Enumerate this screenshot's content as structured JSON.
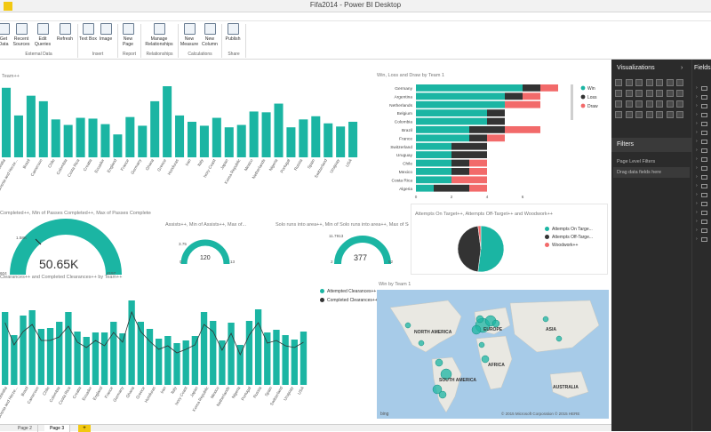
{
  "window": {
    "title": "Fifa2014 - Power BI Desktop"
  },
  "ribbon": {
    "buttons": [
      {
        "label": "Get Data"
      },
      {
        "label": "Recent Sources"
      },
      {
        "label": "Edit Queries"
      },
      {
        "label": "Refresh"
      },
      {
        "label": "Text Box"
      },
      {
        "label": "Image"
      },
      {
        "label": "New Page"
      },
      {
        "label": "Manage Relationships"
      },
      {
        "label": "New Measure"
      },
      {
        "label": "New Column"
      },
      {
        "label": "Publish"
      }
    ],
    "groups": [
      "External Data",
      "Insert",
      "Report",
      "Relationships",
      "Calculations",
      "Share"
    ]
  },
  "visuals": {
    "top_bar_title": "Team++",
    "top_bar_labels": [
      "Australia",
      "Bosnia and Herze...",
      "Brazil",
      "Cameroon",
      "Chile",
      "Colombia",
      "Costa Rica",
      "Croatia",
      "Ecuador",
      "England",
      "France",
      "Germany",
      "Ghana",
      "Greece",
      "Honduras",
      "Iran",
      "Italy",
      "Ivory Coast",
      "Japan",
      "Korea Republic",
      "Mexico",
      "Netherlands",
      "Nigeria",
      "Portugal",
      "Russia",
      "Spain",
      "Switzerland",
      "Uruguay",
      "USA"
    ],
    "stacked_title": "Win, Loss and Draw by Team 1",
    "gauge1_title": "Completed++, Min of Passes Completed++, Max of Passes Completed++",
    "gauge1": {
      "value": "50.65K",
      "target": "1.58K",
      "min": "604",
      "max": "4157"
    },
    "gauge2_title": "Assists++, Min of Assists++, Max of...",
    "gauge2": {
      "value": "120",
      "target": "3.75",
      "min": "0",
      "max": "13"
    },
    "gauge3_title": "Solo runs into area++, Min of Solo runs into area++, Max of Solo runs into...",
    "gauge3": {
      "value": "377",
      "target": "11.7913",
      "min": "2",
      "max": "52"
    },
    "pie_title": "Attempts On Target++, Attempts Off-Target++ and Woodwork++",
    "clear_title": "Clearances++ and Completed Clearances++ by Team++",
    "clear_labels": [
      "Australia",
      "Bosnia and Herze...",
      "Brazil",
      "Cameroon",
      "Chile",
      "Colombia",
      "Costa Rica",
      "Croatia",
      "Ecuador",
      "England",
      "France",
      "Germany",
      "Ghana",
      "Greece",
      "Honduras",
      "Iran",
      "Italy",
      "Ivory Coast",
      "Japan",
      "Korea Republic",
      "Mexico",
      "Netherlands",
      "Nigeria",
      "Portugal",
      "Russia",
      "Spain",
      "Switzerland",
      "Uruguay",
      "USA"
    ],
    "map_title": "Win by Team 1",
    "map_labels": [
      "NORTH AMERICA",
      "EUROPE",
      "ASIA",
      "AFRICA",
      "SOUTH AMERICA",
      "AUSTRALIA"
    ],
    "map_credit": "© 2015 Microsoft Corporation   © 2015 HERE",
    "map_brand": "bing"
  },
  "panes": {
    "visualizations": "Visualizations",
    "filters": "Filters",
    "page_level_filters": "Page Level Filters",
    "drag_fields": "Drag data fields here",
    "fields": "Fields"
  },
  "pages": [
    "Page 2",
    "Page 3"
  ],
  "add_page": "+",
  "colors": {
    "teal": "#1bb5a3",
    "dark": "#333333",
    "red": "#f26a6a"
  },
  "chart_data": [
    {
      "type": "bar",
      "categories": [
        "Australia",
        "Bosnia and Herze...",
        "Brazil",
        "Cameroon",
        "Chile",
        "Colombia",
        "Costa Rica",
        "Croatia",
        "Ecuador",
        "England",
        "France",
        "Germany",
        "Ghana",
        "Greece",
        "Honduras",
        "Iran",
        "Italy",
        "Ivory Coast",
        "Japan",
        "Korea Republic",
        "Mexico",
        "Netherlands",
        "Nigeria",
        "Portugal",
        "Russia",
        "Spain",
        "Switzerland",
        "Uruguay",
        "USA"
      ],
      "values": [
        88,
        53,
        78,
        71,
        48,
        41,
        50,
        49,
        42,
        29,
        51,
        40,
        71,
        90,
        53,
        45,
        40,
        50,
        38,
        41,
        58,
        57,
        68,
        38,
        48,
        52,
        43,
        39,
        45
      ],
      "title": "Team++"
    },
    {
      "type": "bar",
      "title": "Win, Loss and Draw by Team 1",
      "categories": [
        "Germany",
        "Argentina",
        "Netherlands",
        "Belgium",
        "Colombia",
        "Brazil",
        "France",
        "Switzerland",
        "Uruguay",
        "Chile",
        "Mexico",
        "Costa Rica",
        "Algeria"
      ],
      "series": [
        {
          "name": "Win",
          "values": [
            6,
            5,
            5,
            4,
            4,
            3,
            3,
            2,
            2,
            2,
            2,
            2,
            1
          ]
        },
        {
          "name": "Loss",
          "values": [
            1,
            1,
            0,
            1,
            1,
            2,
            1,
            2,
            2,
            1,
            1,
            0,
            2
          ]
        },
        {
          "name": "Draw",
          "values": [
            1,
            1,
            2,
            0,
            0,
            2,
            1,
            0,
            0,
            1,
            1,
            2,
            1
          ]
        }
      ],
      "xlim": [
        0,
        8
      ],
      "xticks": [
        0,
        2,
        4,
        6
      ]
    },
    {
      "type": "pie",
      "title": "Attempts On Target++, Attempts Off-Target++ and Woodwork++",
      "labels": [
        "Attempts On Targe...",
        "Attempts Off-Targe...",
        "Woodwork++"
      ],
      "values": [
        52,
        46,
        2
      ]
    },
    {
      "type": "bar",
      "title": "Clearances++ and Completed Clearances++ by Team++",
      "categories": [
        "Australia",
        "Bosnia and Herze...",
        "Brazil",
        "Cameroon",
        "Chile",
        "Colombia",
        "Costa Rica",
        "Croatia",
        "Ecuador",
        "England",
        "France",
        "Germany",
        "Ghana",
        "Greece",
        "Honduras",
        "Iran",
        "Italy",
        "Ivory Coast",
        "Japan",
        "Korea Republic",
        "Mexico",
        "Netherlands",
        "Nigeria",
        "Portugal",
        "Russia",
        "Spain",
        "Switzerland",
        "Uruguay",
        "USA"
      ],
      "series": [
        {
          "name": "Attempted Clearances++",
          "values": [
            82,
            56,
            78,
            84,
            63,
            64,
            71,
            82,
            60,
            54,
            59,
            59,
            71,
            58,
            95,
            71,
            63,
            52,
            55,
            47,
            50,
            55,
            82,
            72,
            50,
            70,
            45,
            72,
            85,
            59,
            62,
            56,
            51,
            60
          ]
        },
        {
          "name": "Completed Clearances++",
          "values": [
            70,
            45,
            60,
            68,
            50,
            50,
            54,
            66,
            48,
            42,
            50,
            44,
            59,
            48,
            82,
            60,
            49,
            40,
            44,
            36,
            40,
            45,
            68,
            60,
            39,
            58,
            34,
            56,
            70,
            47,
            50,
            44,
            42,
            48
          ]
        }
      ]
    }
  ]
}
